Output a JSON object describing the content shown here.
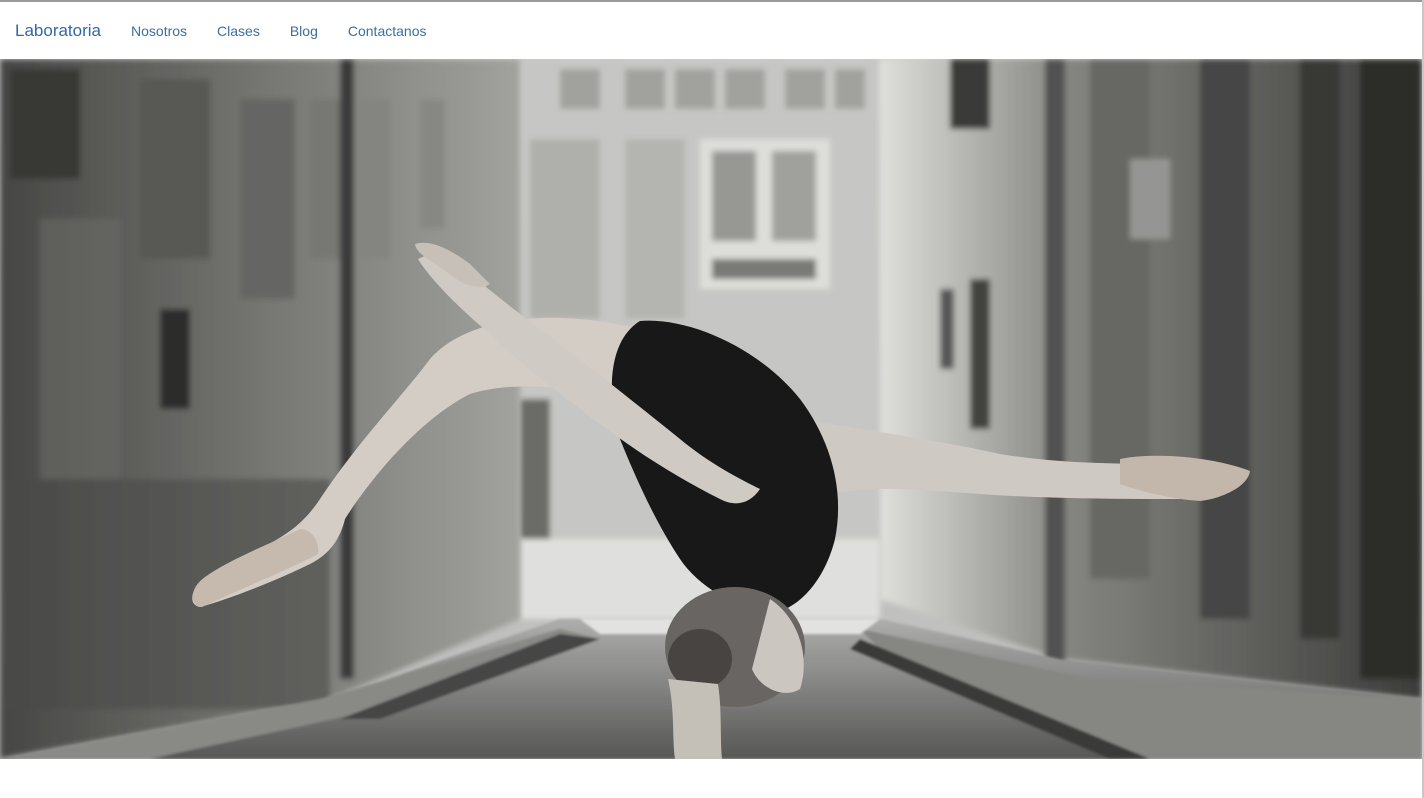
{
  "navbar": {
    "brand": "Laboratoria",
    "items": [
      {
        "label": "Nosotros"
      },
      {
        "label": "Clases"
      },
      {
        "label": "Blog"
      },
      {
        "label": "Contactanos"
      }
    ]
  },
  "hero": {
    "image": "black-and-white photo of a ballet dancer in a backbend split in a narrow street",
    "style": "grayscale"
  },
  "colors": {
    "brand": "#2f6aa6",
    "link": "#3b6f9f",
    "background": "#ffffff"
  }
}
